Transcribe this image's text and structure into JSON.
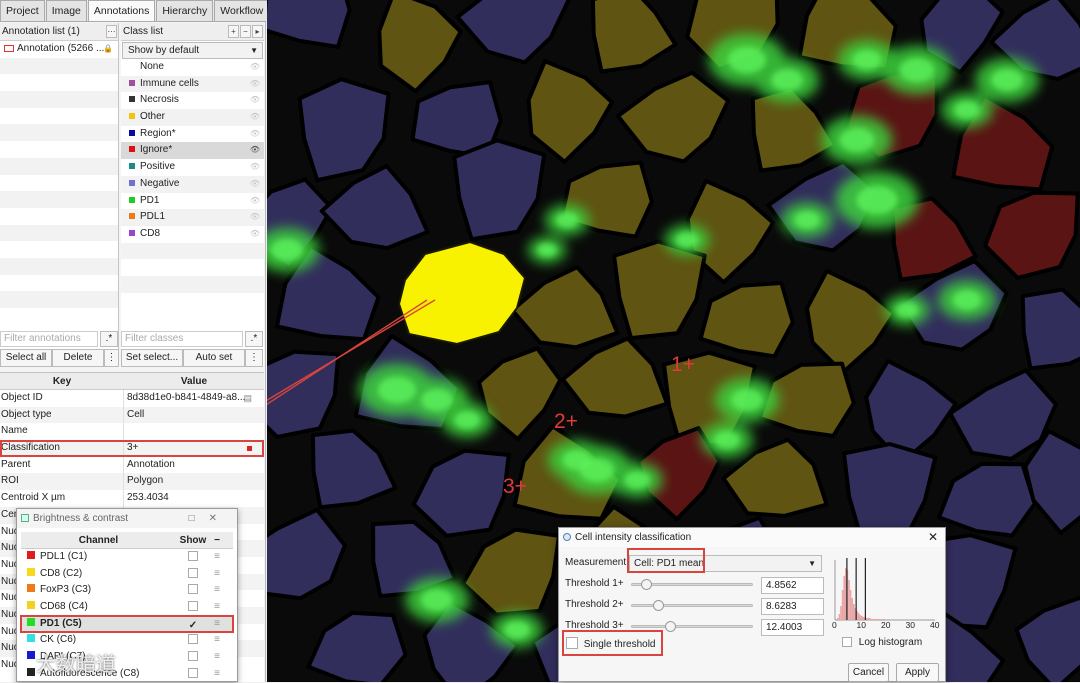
{
  "tabs": [
    "Project",
    "Image",
    "Annotations",
    "Hierarchy",
    "Workflow"
  ],
  "annotation_list": {
    "title": "Annotation list (1)",
    "items": [
      "Annotation (5266 ..."
    ],
    "filter_placeholder": "Filter annotations",
    "select_all": "Select all",
    "delete": "Delete"
  },
  "class_list": {
    "title": "Class list",
    "show_default": "Show by default",
    "items": [
      {
        "name": "None",
        "color": "#ffffff"
      },
      {
        "name": "Immune cells",
        "color": "#a0509e"
      },
      {
        "name": "Necrosis",
        "color": "#333333"
      },
      {
        "name": "Other",
        "color": "#f1c40f"
      },
      {
        "name": "Region*",
        "color": "#0a0a9e"
      },
      {
        "name": "Ignore*",
        "color": "#dd1111"
      },
      {
        "name": "Positive",
        "color": "#1f8a8a"
      },
      {
        "name": "Negative",
        "color": "#7070d0"
      },
      {
        "name": "PD1",
        "color": "#22cc22"
      },
      {
        "name": "PDL1",
        "color": "#f07a1a"
      },
      {
        "name": "CD8",
        "color": "#9944cc"
      }
    ],
    "selected_index": 5,
    "filter_placeholder": "Filter classes",
    "set_selected": "Set select...",
    "auto_set": "Auto set"
  },
  "properties": {
    "key_header": "Key",
    "value_header": "Value",
    "rows": [
      {
        "key": "Object ID",
        "value": "8d38d1e0-b841-4849-a8..."
      },
      {
        "key": "Object type",
        "value": "Cell"
      },
      {
        "key": "Name",
        "value": ""
      },
      {
        "key": "Classification",
        "value": "3+"
      },
      {
        "key": "Parent",
        "value": "Annotation"
      },
      {
        "key": "ROI",
        "value": "Polygon"
      },
      {
        "key": "Centroid X µm",
        "value": "253.4034"
      },
      {
        "key": "Cen",
        "value": ""
      },
      {
        "key": "Nuc",
        "value": ""
      },
      {
        "key": "Nuc",
        "value": ""
      },
      {
        "key": "Nuc",
        "value": ""
      },
      {
        "key": "Nuc",
        "value": ""
      },
      {
        "key": "Nuc",
        "value": ""
      },
      {
        "key": "Nuc",
        "value": ""
      },
      {
        "key": "Nuc",
        "value": ""
      },
      {
        "key": "Nuc",
        "value": ""
      },
      {
        "key": "Nuc",
        "value": ""
      }
    ]
  },
  "brightness": {
    "title": "Brightness & contrast",
    "channel_header": "Channel",
    "show_header": "Show",
    "channels": [
      {
        "name": "PDL1 (C1)",
        "color": "#e01b1b",
        "checked": false
      },
      {
        "name": "CD8 (C2)",
        "color": "#f5d91a",
        "checked": false
      },
      {
        "name": "FoxP3 (C3)",
        "color": "#f07a1a",
        "checked": false
      },
      {
        "name": "CD68 (C4)",
        "color": "#f2d21a",
        "checked": false
      },
      {
        "name": "PD1 (C5)",
        "color": "#22dd22",
        "checked": true
      },
      {
        "name": "CK (C6)",
        "color": "#33e0e0",
        "checked": false
      },
      {
        "name": "DAPI (C7)",
        "color": "#1a1ad0",
        "checked": false
      },
      {
        "name": "Autofluorescence (C8)",
        "color": "#222222",
        "checked": false
      }
    ],
    "check_mark": "✓"
  },
  "cell_intensity": {
    "title": "Cell intensity classification",
    "measurement_label": "Measurement",
    "measurement_value": "Cell: PD1 mean",
    "thresholds": [
      {
        "label": "Threshold 1+",
        "value": "4.8562",
        "fraction": 0.12
      },
      {
        "label": "Threshold 2+",
        "value": "8.6283",
        "fraction": 0.22
      },
      {
        "label": "Threshold 3+",
        "value": "12.4003",
        "fraction": 0.32
      }
    ],
    "single_threshold": "Single threshold",
    "log_histogram": "Log histogram",
    "histogram_ticks": [
      "0",
      "10",
      "20",
      "30",
      "40"
    ],
    "cancel": "Cancel",
    "apply": "Apply"
  },
  "image_labels": [
    "1+",
    "2+",
    "3+"
  ],
  "watermark": "大数暗道"
}
